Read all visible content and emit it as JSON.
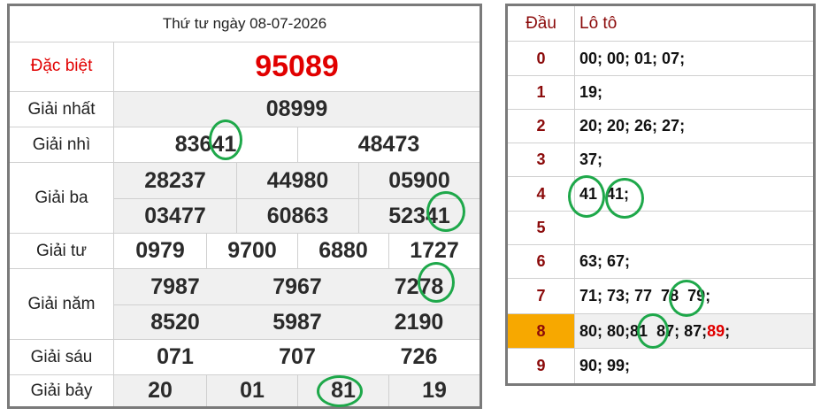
{
  "results": {
    "title": "Thứ tư ngày 08-07-2026",
    "special": {
      "label": "Đặc biệt",
      "value": "95089"
    },
    "first": {
      "label": "Giải nhất",
      "value": "08999"
    },
    "second": {
      "label": "Giải nhì",
      "values": [
        "83641",
        "48473"
      ]
    },
    "third": {
      "label": "Giải ba",
      "values": [
        "28237",
        "44980",
        "05900",
        "03477",
        "60863",
        "52341"
      ]
    },
    "fourth": {
      "label": "Giải tư",
      "values": [
        "0979",
        "9700",
        "6880",
        "1727"
      ]
    },
    "fifth": {
      "label": "Giải năm",
      "values": [
        "7987",
        "7967",
        "7278",
        "8520",
        "5987",
        "2190"
      ]
    },
    "sixth": {
      "label": "Giải sáu",
      "values": [
        "071",
        "707",
        "726"
      ]
    },
    "seventh": {
      "label": "Giải bảy",
      "values": [
        "20",
        "01",
        "81",
        "19"
      ]
    }
  },
  "loto": {
    "header": {
      "dau": "Đầu",
      "loto": "Lô tô"
    },
    "rows": [
      {
        "dau": "0",
        "values": "00; 00; 01; 07;"
      },
      {
        "dau": "1",
        "values": "19;"
      },
      {
        "dau": "2",
        "values": "20; 20; 26; 27;"
      },
      {
        "dau": "3",
        "values": "37;"
      },
      {
        "dau": "4",
        "values": "41  41;"
      },
      {
        "dau": "5",
        "values": ""
      },
      {
        "dau": "6",
        "values": "63; 67;"
      },
      {
        "dau": "7",
        "values": "71; 73; 77  78  79;"
      },
      {
        "dau": "8",
        "values": "80; 80;",
        "values_b": "81  87; 87;",
        "special": "89",
        "tail": ";"
      },
      {
        "dau": "9",
        "values": "90; 99;"
      }
    ]
  },
  "colors": {
    "red": "#e10000",
    "highlight": "#f7a800",
    "circle": "#1ea84a",
    "border": "#7a7a7a"
  }
}
